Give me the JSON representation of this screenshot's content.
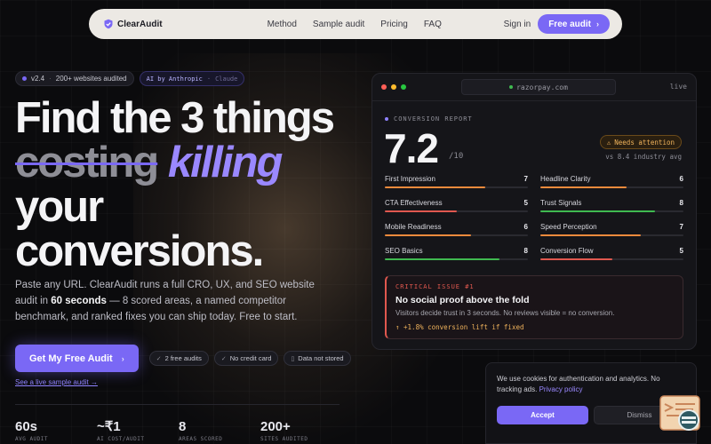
{
  "nav": {
    "logo": "ClearAudit",
    "links": [
      "Method",
      "Sample audit",
      "Pricing",
      "FAQ"
    ],
    "signin": "Sign in",
    "cta": "Free audit",
    "cta_icon": "chevron-right-icon"
  },
  "badges": {
    "version": "v2.4",
    "audited": "200+ websites audited",
    "anthropic": "AI by Anthropic",
    "claude": "Claude"
  },
  "hero": {
    "line1": "Find the 3 things",
    "strike": "costing",
    "accent": "killing",
    "line3": "your",
    "line4": "conversions",
    "period": ".",
    "sub_pre": "Paste any URL. ClearAudit runs a full CRO, UX, and SEO website audit in ",
    "sub_bold": "60 seconds",
    "sub_post": " — 8 scored areas, a named competitor benchmark, and ranked fixes you can ship today. Free to start.",
    "cta": "Get My Free Audit",
    "pills": [
      "2 free audits",
      "No credit card",
      "Data not stored"
    ],
    "pill_icons": [
      "check-icon",
      "check-icon",
      "lock-icon"
    ],
    "live_link": "See a live sample audit →"
  },
  "stats": [
    {
      "value": "60s",
      "label": "AVG AUDIT"
    },
    {
      "value": "~₹1",
      "label": "AI COST/AUDIT"
    },
    {
      "value": "8",
      "label": "AREAS SCORED"
    },
    {
      "value": "200+",
      "label": "SITES AUDITED"
    }
  ],
  "report": {
    "url": "razorpay.com",
    "live": "live",
    "label": "CONVERSION REPORT",
    "score": "7.2",
    "denominator": "/10",
    "attention": "Needs attention",
    "benchmark": "vs 8.4 industry avg",
    "metrics": [
      {
        "name": "First Impression",
        "value": "7",
        "fill": 0.7,
        "color": "#f08a3c"
      },
      {
        "name": "Headline Clarity",
        "value": "6",
        "fill": 0.6,
        "color": "#f08a3c"
      },
      {
        "name": "CTA Effectiveness",
        "value": "5",
        "fill": 0.5,
        "color": "#e0584f"
      },
      {
        "name": "Trust Signals",
        "value": "8",
        "fill": 0.8,
        "color": "#3fb950"
      },
      {
        "name": "Mobile Readiness",
        "value": "6",
        "fill": 0.6,
        "color": "#f08a3c"
      },
      {
        "name": "Speed Perception",
        "value": "7",
        "fill": 0.7,
        "color": "#f08a3c"
      },
      {
        "name": "SEO Basics",
        "value": "8",
        "fill": 0.8,
        "color": "#3fb950"
      },
      {
        "name": "Conversion Flow",
        "value": "5",
        "fill": 0.5,
        "color": "#e0584f"
      }
    ],
    "critical": {
      "label": "CRITICAL ISSUE #1",
      "title": "No social proof above the fold",
      "desc": "Visitors decide trust in 3 seconds. No reviews visible = no conversion.",
      "impact": "↑ +1.8% conversion lift if fixed"
    }
  },
  "cookie": {
    "text": "We use cookies for authentication and analytics. No tracking ads.",
    "link": "Privacy policy",
    "accept": "Accept",
    "dismiss": "Dismiss"
  },
  "colors": {
    "accent": "#7a68f5",
    "accent_light": "#9a88ff",
    "warning": "#f0b35c",
    "danger": "#e0584f",
    "success": "#3fb950"
  }
}
